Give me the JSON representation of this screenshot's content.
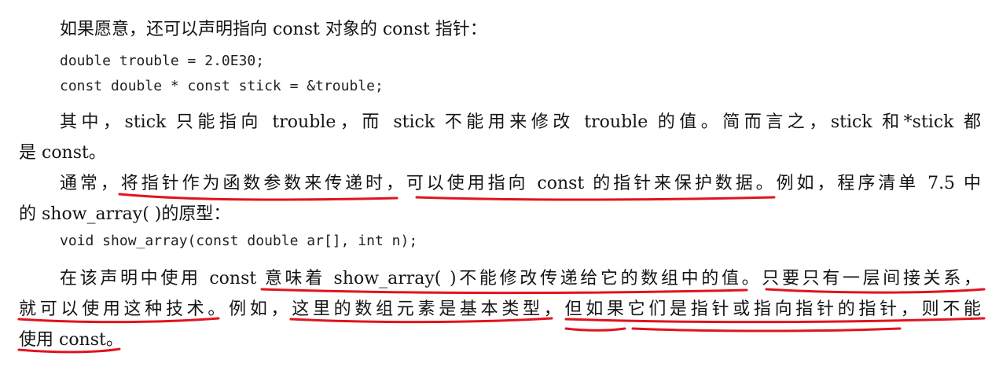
{
  "document": {
    "intro": "如果愿意，还可以声明指向 const 对象的 const 指针：",
    "code_block_1": [
      "double trouble = 2.0E30;",
      "const double * const stick = &trouble;"
    ],
    "para1_line1": "其中，stick 只能指向 trouble，而 stick 不能用来修改 trouble 的值。简而言之，stick 和*stick 都",
    "para1_line2": "是 const。",
    "para2_line1": "通常，将指针作为函数参数来传递时，可以使用指向 const 的指针来保护数据。例如，程序清单 7.5 中",
    "para2_line2": "的 show_array( )的原型：",
    "code_block_2": [
      "void show_array(const double ar[], int n);"
    ],
    "para3_line1": "在该声明中使用 const 意味着 show_array( )不能修改传递给它的数组中的值。只要只有一层间接关系，",
    "para3_line2": "就可以使用这种技术。例如，这里的数组元素是基本类型，但如果它们是指针或指向指针的指针，则不能",
    "para3_line3": "使用 const。"
  },
  "colors": {
    "text": "#141414",
    "annotation_underline": "#e0141e"
  }
}
